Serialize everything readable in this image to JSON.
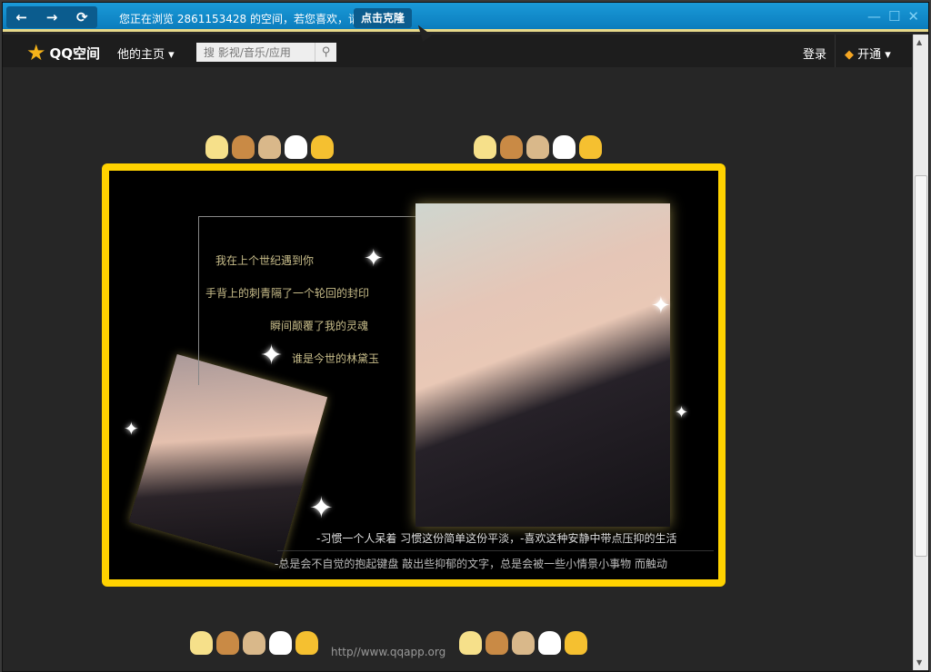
{
  "titlebar": {
    "back_icon": "arrow-left",
    "forward_icon": "arrow-right",
    "refresh_icon": "refresh",
    "notice": "您正在浏览 2861153428 的空间，若您喜欢，请",
    "clone_button": "点击克隆",
    "minimize": "—",
    "maximize": "☐",
    "close": "✕"
  },
  "nav": {
    "logo": "QQ空间",
    "home": "他的主页 ▾",
    "search_placeholder": "搜 影视/音乐/应用",
    "login": "登录",
    "open": "开通 ▾"
  },
  "poem": [
    "我在上个世纪遇到你",
    "手背上的刺青隔了一个轮回的封印",
    "瞬间颠覆了我的灵魂",
    "谁是今世的林黛玉"
  ],
  "captions": [
    "-习惯一个人呆着 习惯这份简单这份平淡，-喜欢这种安静中带点压抑的生活",
    "-总是会不自觉的抱起键盘 敲出些抑郁的文字，总是会被一些小情景小事物 而触动"
  ],
  "footer": {
    "url": "http//www.qqapp.org"
  },
  "critter_colors": [
    "#f6e08a",
    "#c98a45",
    "#d9b88a",
    "#ffffff",
    "#f5c030"
  ]
}
